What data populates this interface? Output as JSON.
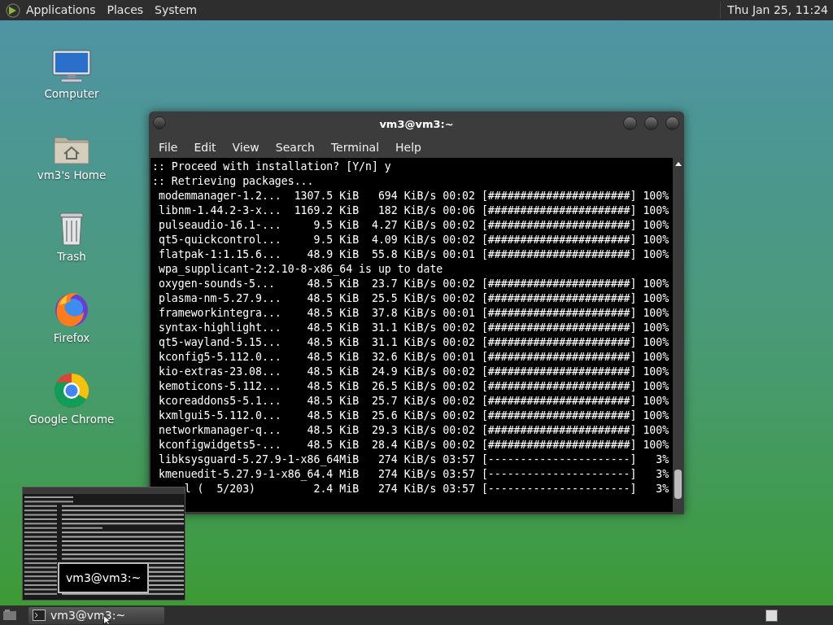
{
  "top_panel": {
    "menus": [
      "Applications",
      "Places",
      "System"
    ],
    "clock": "Thu Jan 25, 11:24"
  },
  "desktop_icons": [
    {
      "kind": "computer",
      "label": "Computer"
    },
    {
      "kind": "home",
      "label": "vm3's Home"
    },
    {
      "kind": "trash",
      "label": "Trash"
    },
    {
      "kind": "fox",
      "label": "Firefox"
    },
    {
      "kind": "ring",
      "label": "Google Chrome"
    }
  ],
  "terminal": {
    "title": "vm3@vm3:~",
    "menu": [
      "File",
      "Edit",
      "View",
      "Search",
      "Terminal",
      "Help"
    ],
    "lines": [
      ":: Proceed with installation? [Y/n] y",
      ":: Retrieving packages...",
      " modemmanager-1.2...  1307.5 KiB   694 KiB/s 00:02 [######################] 100%",
      " libnm-1.44.2-3-x...  1169.2 KiB   182 KiB/s 00:06 [######################] 100%",
      " pulseaudio-16.1-...     9.5 KiB  4.27 KiB/s 00:02 [######################] 100%",
      " qt5-quickcontrol...     9.5 KiB  4.09 KiB/s 00:02 [######################] 100%",
      " flatpak-1:1.15.6...    48.9 KiB  55.8 KiB/s 00:01 [######################] 100%",
      " wpa_supplicant-2:2.10-8-x86_64 is up to date",
      " oxygen-sounds-5...     48.5 KiB  23.7 KiB/s 00:02 [######################] 100%",
      " plasma-nm-5.27.9...    48.5 KiB  25.5 KiB/s 00:02 [######################] 100%",
      " frameworkintegra...    48.5 KiB  37.8 KiB/s 00:01 [######################] 100%",
      " syntax-highlight...    48.5 KiB  31.1 KiB/s 00:02 [######################] 100%",
      " qt5-wayland-5.15...    48.5 KiB  31.1 KiB/s 00:02 [######################] 100%",
      " kconfig5-5.112.0...    48.5 KiB  32.6 KiB/s 00:01 [######################] 100%",
      " kio-extras-23.08...    48.5 KiB  24.9 KiB/s 00:02 [######################] 100%",
      " kemoticons-5.112...    48.5 KiB  26.5 KiB/s 00:02 [######################] 100%",
      " kcoreaddons5-5.1...    48.5 KiB  25.7 KiB/s 00:02 [######################] 100%",
      " kxmlgui5-5.112.0...    48.5 KiB  25.6 KiB/s 00:02 [######################] 100%",
      " networkmanager-q...    48.5 KiB  29.3 KiB/s 00:02 [######################] 100%",
      " kconfigwidgets5-...    48.5 KiB  28.4 KiB/s 00:02 [######################] 100%",
      " libksysguard-5.27.9-1-x86_64MiB   274 KiB/s 03:57 [----------------------]   3%",
      " kmenuedit-5.27.9-1-x86_64.4 MiB   274 KiB/s 03:57 [----------------------]   3%",
      "     l (  5/203)         2.4 MiB   274 KiB/s 03:57 [----------------------]   3%"
    ]
  },
  "preview": {
    "title": "vm3@vm3:~"
  },
  "taskbar": {
    "tasks": [
      {
        "label": "vm3@vm3:~",
        "selected": true
      }
    ]
  }
}
